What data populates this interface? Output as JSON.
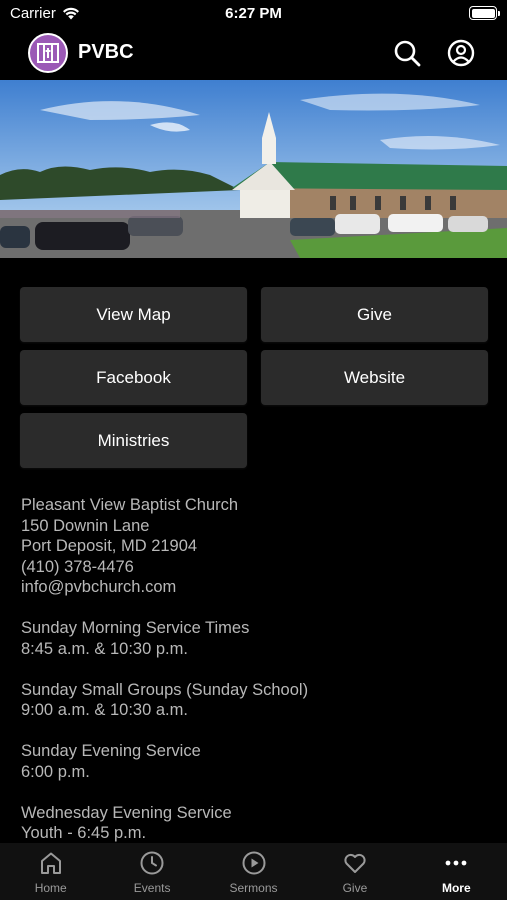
{
  "status_bar": {
    "carrier": "Carrier",
    "time": "6:27 PM"
  },
  "header": {
    "title": "PVBC",
    "search_icon": "search-icon",
    "account_icon": "account-icon"
  },
  "buttons": {
    "view_map": "View Map",
    "give": "Give",
    "facebook": "Facebook",
    "website": "Website",
    "ministries": "Ministries"
  },
  "info": {
    "church_name": "Pleasant View Baptist Church",
    "address_line1": "150 Downin Lane",
    "address_line2": "Port Deposit, MD 21904",
    "phone": "(410) 378-4476",
    "email": "info@pvbchurch.com",
    "morning_title": "Sunday Morning Service Times",
    "morning_times": "8:45 a.m. & 10:30 p.m.",
    "small_groups_title": "Sunday Small Groups (Sunday School)",
    "small_groups_times": "9:00 a.m. & 10:30 a.m.",
    "evening_title": "Sunday Evening Service",
    "evening_time": "6:00 p.m.",
    "wednesday_title": "Wednesday Evening Service",
    "wednesday_youth": "Youth - 6:45 p.m."
  },
  "tabs": [
    {
      "label": "Home",
      "icon": "home-icon"
    },
    {
      "label": "Events",
      "icon": "clock-icon"
    },
    {
      "label": "Sermons",
      "icon": "play-circle-icon"
    },
    {
      "label": "Give",
      "icon": "heart-icon"
    },
    {
      "label": "More",
      "icon": "more-icon",
      "active": true
    }
  ],
  "colors": {
    "background": "#000000",
    "button": "#2b2b2b",
    "logo": "#9b59b6",
    "tab_active": "#ffffff",
    "tab_inactive": "#9a9a9a"
  }
}
